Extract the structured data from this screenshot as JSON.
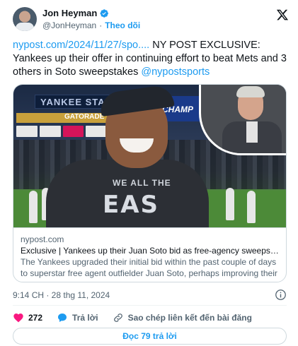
{
  "author": {
    "display_name": "Jon Heyman",
    "handle": "@JonHeyman",
    "separator": "·",
    "follow_label": "Theo dõi"
  },
  "tweet": {
    "link_text": "nypost.com/2024/11/27/spo....",
    "body_text": " NY POST EXCLUSIVE: Yankees up their offer in continuing effort to beat Mets and 3 others in Soto sweepstakes ",
    "mention": "@nypostsports"
  },
  "photo": {
    "scoreboard_text": "YANKEE STA",
    "ad_text": "GATORADE",
    "banner_text": "CHAMP",
    "shirt_top": "WE ALL THE",
    "shirt_main": "EAS"
  },
  "link_card": {
    "domain": "nypost.com",
    "title": "Exclusive | Yankees up their Juan Soto bid as free-agency sweepstakes re...",
    "description": "The Yankees upgraded their initial bid within the past couple of days to superstar free agent outfielder Juan Soto, perhaps improving their ..."
  },
  "meta": {
    "timestamp": "9:14 CH · 28 thg 11, 2024"
  },
  "actions": {
    "like_count": "272",
    "reply_label": "Trả lời",
    "copy_link_label": "Sao chép liên kết đến bài đăng"
  },
  "replies_button": "Đọc 79 trả lời",
  "colors": {
    "accent": "#1d9bf0",
    "like": "#f91880",
    "text_secondary": "#536471"
  }
}
